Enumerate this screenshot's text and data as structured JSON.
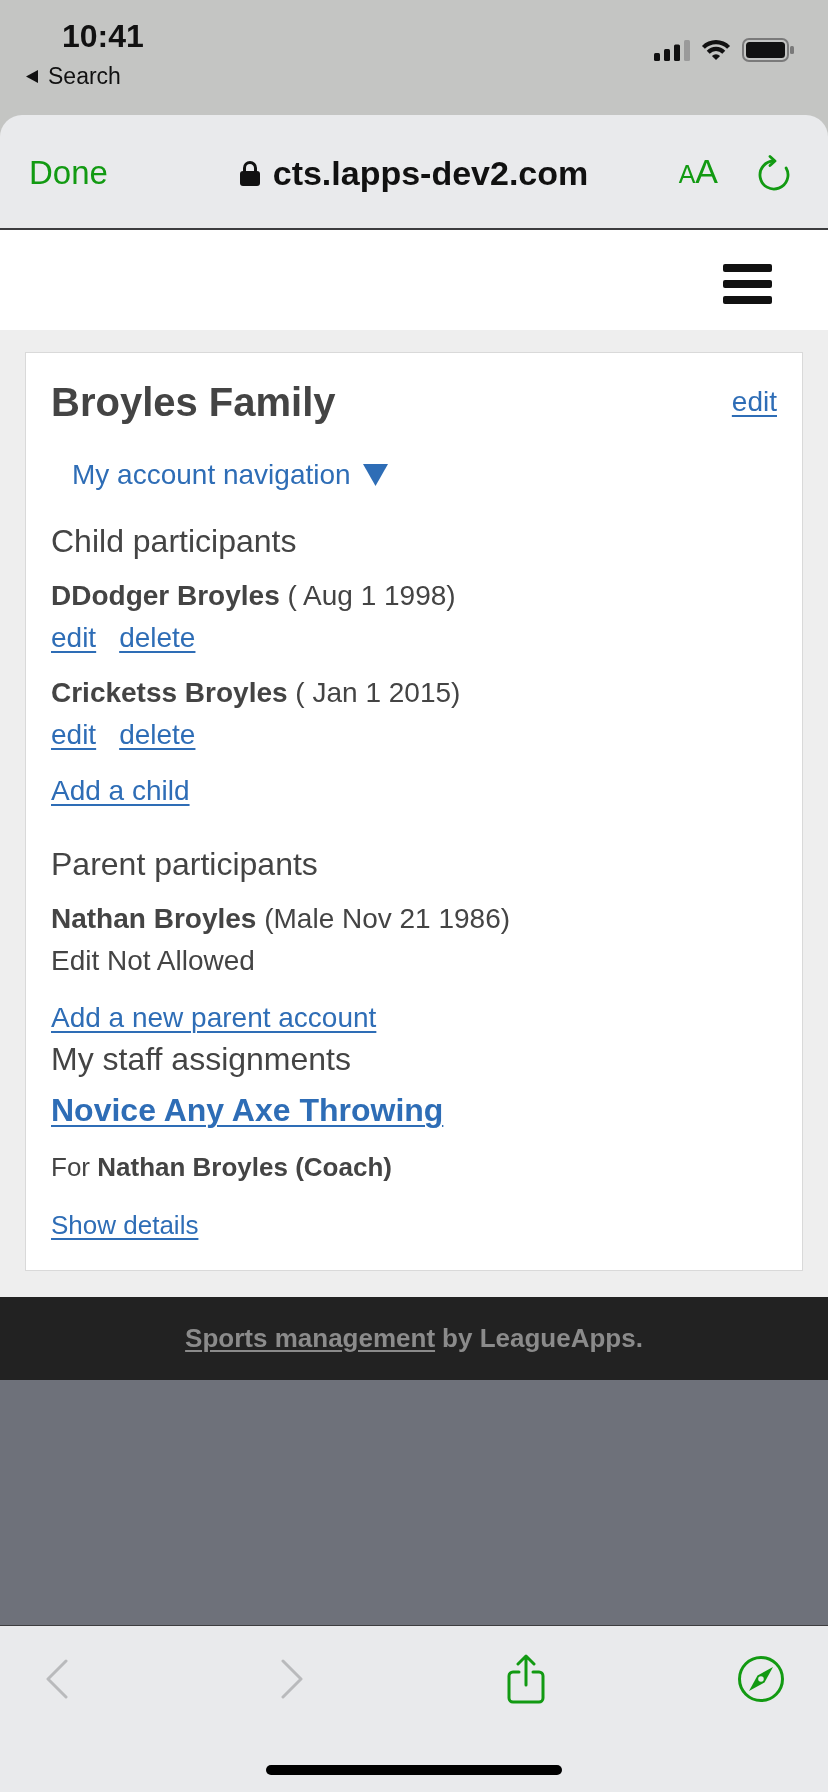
{
  "status_bar": {
    "time": "10:41",
    "back_label": "Search"
  },
  "browser_bar": {
    "done_label": "Done",
    "url": "cts.lapps-dev2.com",
    "text_size_label": "AA"
  },
  "page": {
    "title": "Broyles Family",
    "title_action": "edit",
    "account_nav": "My account navigation",
    "child_section": {
      "heading": "Child participants",
      "participants": [
        {
          "text": "**DDodger Broyles** ( Aug 1 1998)",
          "actions": [
            "edit",
            "delete"
          ]
        },
        {
          "text": "**Cricketss Broyles** ( Jan 1 2015)",
          "actions": [
            "edit",
            "delete"
          ]
        }
      ],
      "add_link": "Add a child"
    },
    "parent_section": {
      "heading": "Parent participants",
      "participants": [
        {
          "text": "**Nathan Broyles** (Male Nov 21 1986)",
          "note": "Edit Not Allowed"
        }
      ],
      "add_link": "Add a new parent account"
    },
    "staff_section": {
      "heading": "My staff assignments",
      "assignments": [
        {
          "program": "Novice Any Axe Throwing",
          "for_text": "For **Nathan Broyles (Coach)**",
          "details_link": "Show details"
        }
      ]
    }
  },
  "footer": {
    "link": "Sports management",
    "text": "by LeagueApps."
  },
  "toolbar": [
    {
      "kind": "back",
      "disabled": true
    },
    {
      "kind": "forward",
      "disabled": true
    },
    {
      "kind": "share",
      "disabled": false
    },
    {
      "kind": "compass",
      "disabled": false
    }
  ]
}
